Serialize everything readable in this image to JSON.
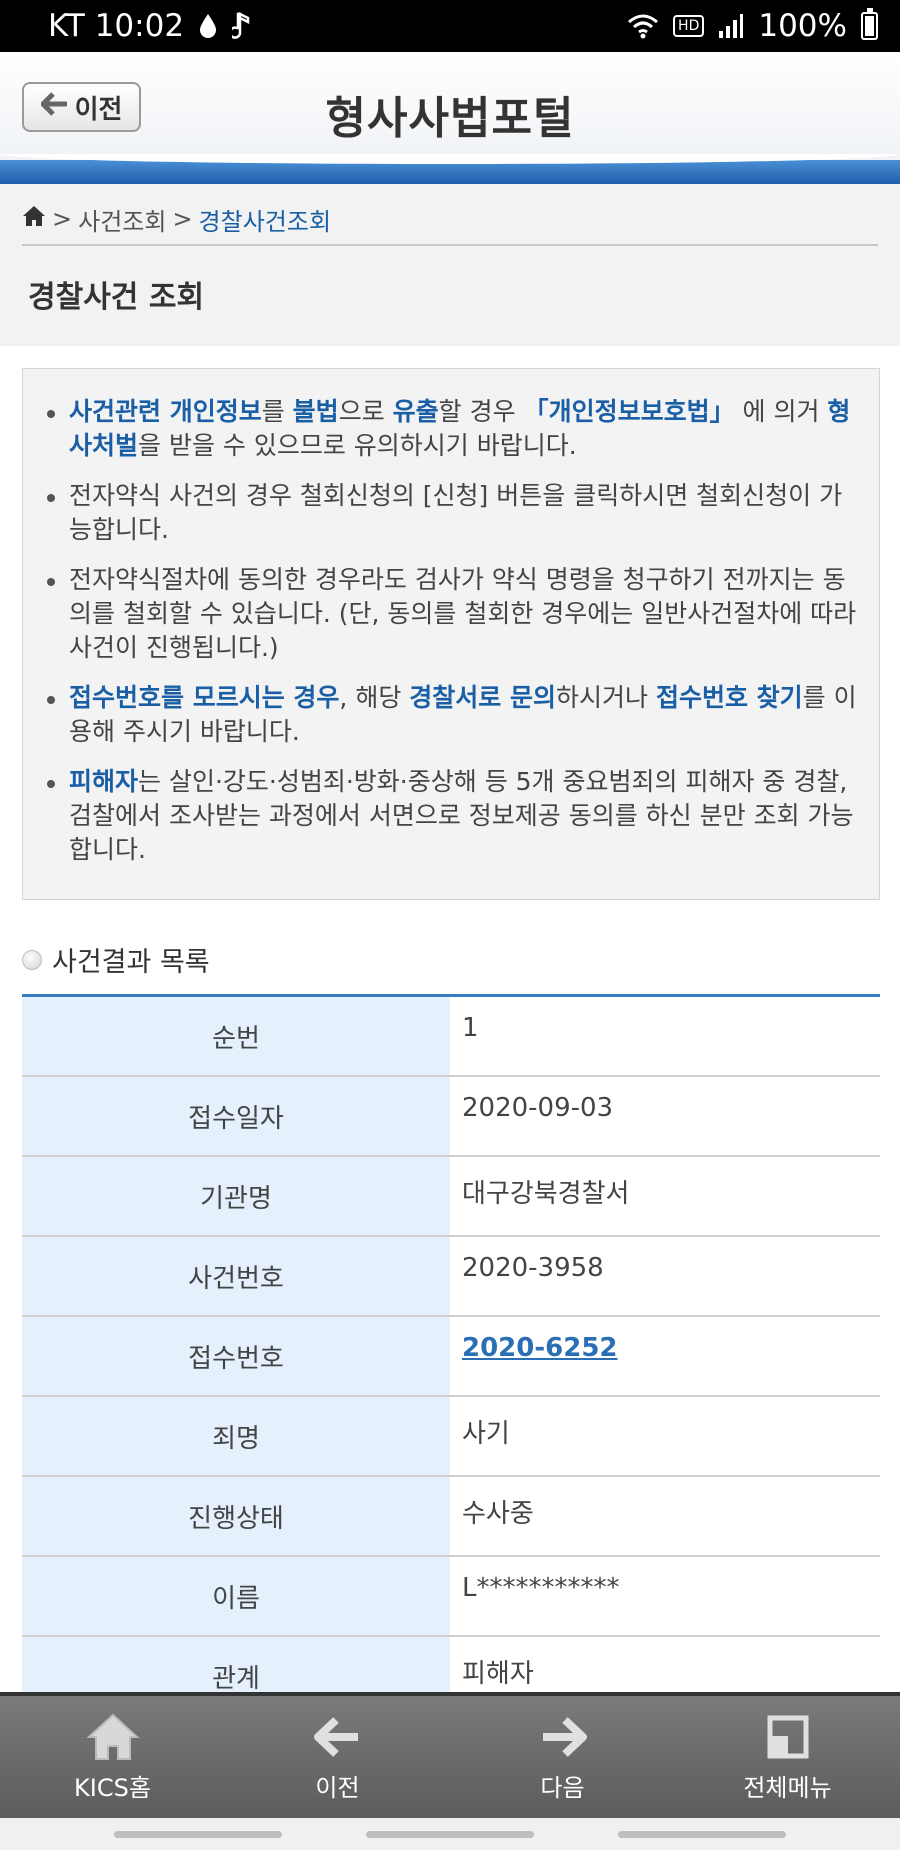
{
  "status_bar": {
    "carrier_time": "KT 10:02",
    "battery": "100%",
    "hd_label": "HD"
  },
  "header": {
    "back_label": "이전",
    "title": "형사사법포털"
  },
  "breadcrumb": {
    "sep1": ">",
    "item1": "사건조회",
    "sep2": ">",
    "current": "경찰사건조회"
  },
  "page_title": "경찰사건 조회",
  "notice": {
    "b1": {
      "p1": "사건관련 개인정보",
      "p2": "를 ",
      "p3": "불법",
      "p4": "으로 ",
      "p5": "유출",
      "p6": "할 경우 ",
      "p7": "「개인정보보호법」",
      "p8": " 에 의거 ",
      "p9": "형사처벌",
      "p10": "을 받을 수 있으므로 유의하시기 바랍니다."
    },
    "b2": "전자약식 사건의 경우 철회신청의 [신청] 버튼을 클릭하시면 철회신청이 가능합니다.",
    "b3": "전자약식절차에 동의한 경우라도 검사가 약식 명령을 청구하기 전까지는 동의를 철회할 수 있습니다. (단, 동의를 철회한 경우에는 일반사건절차에 따라 사건이 진행됩니다.)",
    "b4": {
      "p1": "접수번호를 모르시는 경우",
      "p2": ", 해당 ",
      "p3": "경찰서로 문의",
      "p4": "하시거나 ",
      "p5": "접수번호 찾기",
      "p6": "를 이용해 주시기 바랍니다."
    },
    "b5": {
      "p1": "피해자",
      "p2": "는 살인·강도·성범죄·방화·중상해 등 5개 중요범죄의 피해자 중 경찰, 검찰에서 조사받는 과정에서 서면으로 정보제공 동의를 하신 분만 조회 가능합니다."
    }
  },
  "section_title": "사건결과 목록",
  "table": {
    "rows": [
      {
        "label": "순번",
        "value": "1"
      },
      {
        "label": "접수일자",
        "value": "2020-09-03"
      },
      {
        "label": "기관명",
        "value": "대구강북경찰서"
      },
      {
        "label": "사건번호",
        "value": "2020-3958"
      },
      {
        "label": "접수번호",
        "value": "2020-6252"
      },
      {
        "label": "죄명",
        "value": "사기"
      },
      {
        "label": "진행상태",
        "value": "수사중"
      },
      {
        "label": "이름",
        "value": "L***********"
      },
      {
        "label": "관계",
        "value": "피해자"
      }
    ]
  },
  "bottom_nav": [
    {
      "label": "KICS홈",
      "icon": "home-icon"
    },
    {
      "label": "이전",
      "icon": "arrow-left-icon"
    },
    {
      "label": "다음",
      "icon": "arrow-right-icon"
    },
    {
      "label": "전체메뉴",
      "icon": "menu-icon"
    }
  ]
}
